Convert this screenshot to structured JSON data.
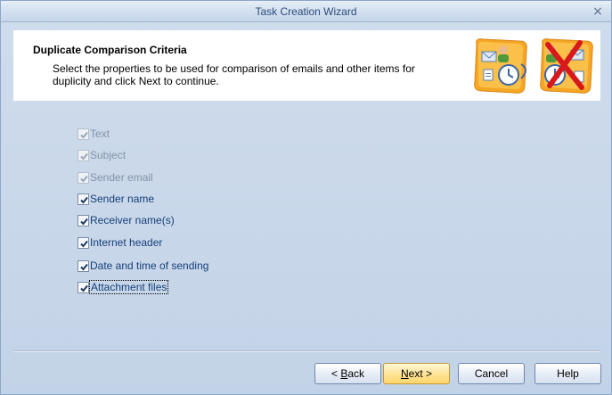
{
  "window": {
    "title": "Task Creation Wizard",
    "close_glyph": "×"
  },
  "header": {
    "title": "Duplicate Comparison Criteria",
    "description": "Select the properties to be used for comparison of emails and other items for duplicity and click Next to continue.",
    "graphic_icon": "email-contacts-compare-icon"
  },
  "options": [
    {
      "label": "Text",
      "checked": true,
      "enabled": false
    },
    {
      "label": "Subject",
      "checked": true,
      "enabled": false
    },
    {
      "label": "Sender email",
      "checked": true,
      "enabled": false
    },
    {
      "label": "Sender name",
      "checked": true,
      "enabled": true
    },
    {
      "label": "Receiver name(s)",
      "checked": true,
      "enabled": true
    },
    {
      "label": "Internet header",
      "checked": true,
      "enabled": true
    },
    {
      "label": "Date and time of sending",
      "checked": true,
      "enabled": true
    },
    {
      "label": "Attachment files",
      "checked": true,
      "enabled": true,
      "focused": true
    }
  ],
  "buttons": {
    "back_prefix": "< ",
    "back_access": "B",
    "back_rest": "ack",
    "next_access": "N",
    "next_rest": "ext >",
    "cancel": "Cancel",
    "help": "Help"
  },
  "colors": {
    "accent_orange": "#f2a23a",
    "label_blue": "#163f7a"
  }
}
